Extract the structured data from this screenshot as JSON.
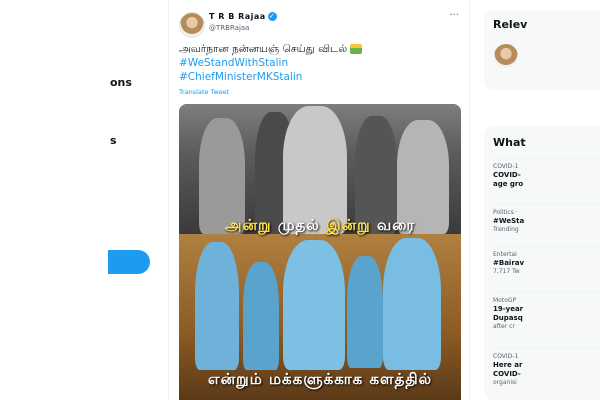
{
  "nav": {
    "item_a": "ons",
    "item_b": "s"
  },
  "tweet": {
    "author_name": "T R B Rajaa",
    "verified_mark": "✓",
    "handle": "@TRBRajaa",
    "text": "அவர்நான நன்னயஞ் செய்து விடல்",
    "hashtags": [
      "#WeStandWithStalin",
      "#ChiefMinisterMKStalin"
    ],
    "translate_label": "Translate Tweet",
    "more_label": "···",
    "image_caption_top": [
      "அன்று",
      "முதல்",
      "இன்று",
      "வரை"
    ],
    "image_caption_bottom": "என்றும் மக்களுக்காக களத்தில்"
  },
  "sidebar": {
    "relevant_title": "Relev",
    "whats_title": "What",
    "trends": [
      {
        "category": "COVID-1",
        "title": "COVID-",
        "title2": "age gro",
        "count": ""
      },
      {
        "category": "Politics ·",
        "title": "#WeSta",
        "title2": "",
        "count": "Trending"
      },
      {
        "category": "Entertai",
        "title": "#Bairav",
        "title2": "",
        "count": "7,717 Tw"
      },
      {
        "category": "MotoGP",
        "title": "19-year",
        "title2": "Dupasq",
        "count": "after cr"
      },
      {
        "category": "COVID-1",
        "title": "Here ar",
        "title2": "COVID-",
        "count": "organisi"
      }
    ]
  },
  "colors": {
    "accent": "#1d9bf0",
    "caption_highlight": "#ffe14a"
  }
}
